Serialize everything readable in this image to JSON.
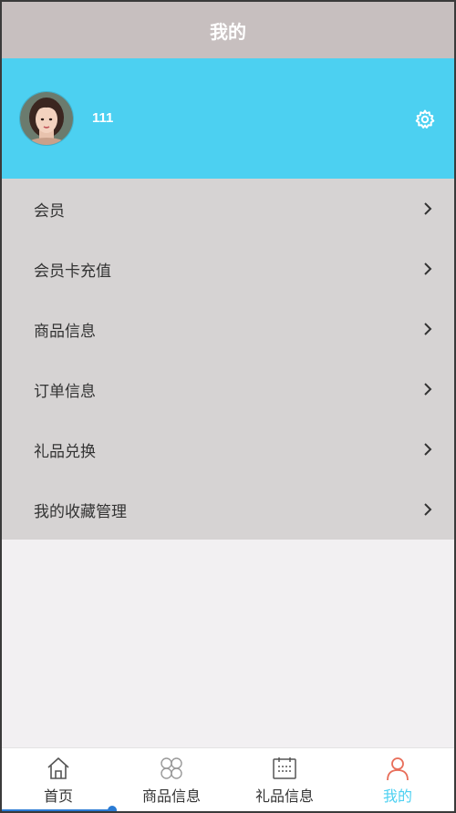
{
  "header": {
    "title": "我的"
  },
  "profile": {
    "username": "111",
    "avatar_icon": "avatar-photo",
    "settings_icon": "gear-icon"
  },
  "menu": {
    "items": [
      {
        "label": "会员"
      },
      {
        "label": "会员卡充值"
      },
      {
        "label": "商品信息"
      },
      {
        "label": "订单信息"
      },
      {
        "label": "礼品兑换"
      },
      {
        "label": "我的收藏管理"
      }
    ]
  },
  "tabbar": {
    "tabs": [
      {
        "label": "首页",
        "icon": "home-icon",
        "active": false
      },
      {
        "label": "商品信息",
        "icon": "grid-icon",
        "active": false
      },
      {
        "label": "礼品信息",
        "icon": "calendar-icon",
        "active": false
      },
      {
        "label": "我的",
        "icon": "user-icon",
        "active": true
      }
    ]
  },
  "colors": {
    "header_bg": "#c7bfbf",
    "profile_bg": "#4cd0f1",
    "menu_bg": "#d6d3d3",
    "page_bg": "#f2f0f2",
    "active_tab": "#4cd0f1",
    "user_icon": "#e86e5a"
  }
}
